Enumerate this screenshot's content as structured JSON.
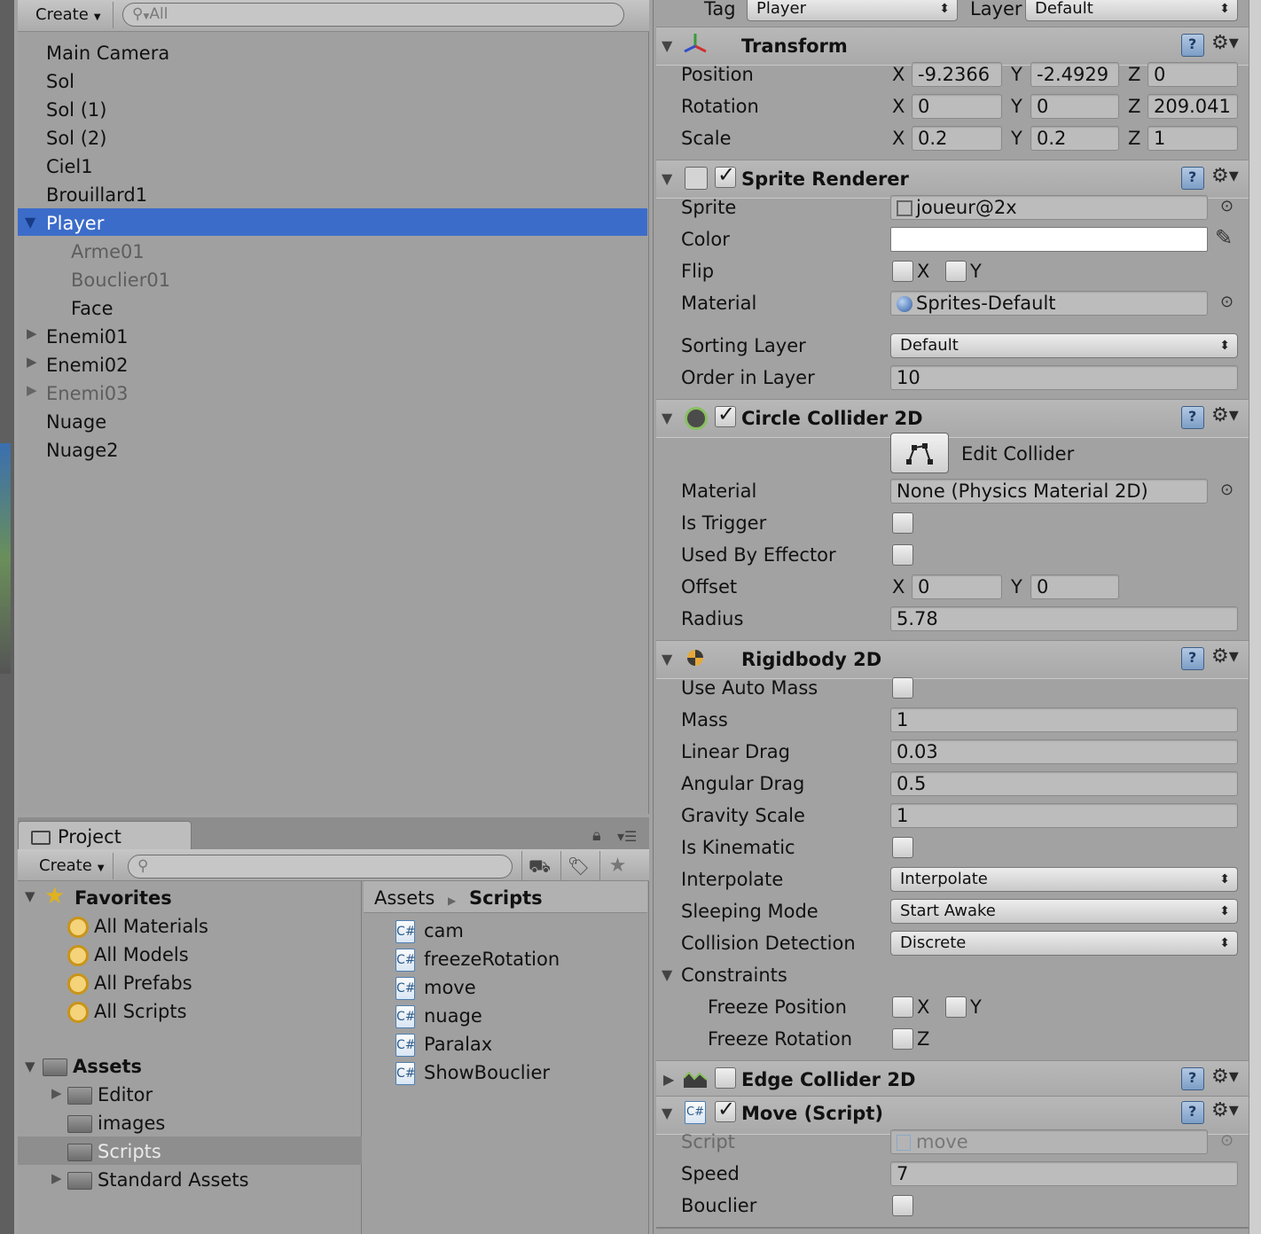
{
  "hierarchy": {
    "create_label": "Create",
    "search_placeholder": "All",
    "items": [
      {
        "label": "Main Camera"
      },
      {
        "label": "Sol"
      },
      {
        "label": "Sol (1)"
      },
      {
        "label": "Sol (2)"
      },
      {
        "label": "Ciel1"
      },
      {
        "label": "Brouillard1"
      },
      {
        "label": "Player"
      },
      {
        "label": "Arme01"
      },
      {
        "label": "Bouclier01"
      },
      {
        "label": "Face"
      },
      {
        "label": "Enemi01"
      },
      {
        "label": "Enemi02"
      },
      {
        "label": "Enemi03"
      },
      {
        "label": "Nuage"
      },
      {
        "label": "Nuage2"
      }
    ]
  },
  "project": {
    "tab_label": "Project",
    "create_label": "Create",
    "favorites_label": "Favorites",
    "favorites": [
      "All Materials",
      "All Models",
      "All Prefabs",
      "All Scripts"
    ],
    "assets_label": "Assets",
    "folders": [
      "Editor",
      "images",
      "Scripts",
      "Standard Assets"
    ],
    "breadcrumb_root": "Assets",
    "breadcrumb_current": "Scripts",
    "files": [
      "cam",
      "freezeRotation",
      "move",
      "nuage",
      "Paralax",
      "ShowBouclier"
    ]
  },
  "inspector": {
    "tag_label": "Tag",
    "tag_value": "Player",
    "layer_label": "Layer",
    "layer_value": "Default",
    "transform": {
      "title": "Transform",
      "position_label": "Position",
      "rotation_label": "Rotation",
      "scale_label": "Scale",
      "x": "X",
      "y": "Y",
      "z": "Z",
      "pos_x": "-9.2366",
      "pos_y": "-2.4929",
      "pos_z": "0",
      "rot_x": "0",
      "rot_y": "0",
      "rot_z": "209.041",
      "scale_x": "0.2",
      "scale_y": "0.2",
      "scale_z": "1"
    },
    "sprite_renderer": {
      "title": "Sprite Renderer",
      "sprite_label": "Sprite",
      "sprite_value": "joueur@2x",
      "color_label": "Color",
      "flip_label": "Flip",
      "flip_x": "X",
      "flip_y": "Y",
      "material_label": "Material",
      "material_value": "Sprites-Default",
      "sorting_layer_label": "Sorting Layer",
      "sorting_layer_value": "Default",
      "order_label": "Order in Layer",
      "order_value": "10"
    },
    "circle_collider": {
      "title": "Circle Collider 2D",
      "edit_label": "Edit Collider",
      "material_label": "Material",
      "material_value": "None (Physics Material 2D)",
      "is_trigger_label": "Is Trigger",
      "used_by_effector_label": "Used By Effector",
      "offset_label": "Offset",
      "offset_x": "0",
      "offset_y": "0",
      "radius_label": "Radius",
      "radius_value": "5.78"
    },
    "rigidbody": {
      "title": "Rigidbody 2D",
      "use_auto_mass_label": "Use Auto Mass",
      "mass_label": "Mass",
      "mass_value": "1",
      "linear_drag_label": "Linear Drag",
      "linear_drag_value": "0.03",
      "angular_drag_label": "Angular Drag",
      "angular_drag_value": "0.5",
      "gravity_label": "Gravity Scale",
      "gravity_value": "1",
      "kinematic_label": "Is Kinematic",
      "interpolate_label": "Interpolate",
      "interpolate_value": "Interpolate",
      "sleeping_label": "Sleeping Mode",
      "sleeping_value": "Start Awake",
      "collision_label": "Collision Detection",
      "collision_value": "Discrete",
      "constraints_label": "Constraints",
      "freeze_pos_label": "Freeze Position",
      "freeze_rot_label": "Freeze Rotation",
      "x": "X",
      "y": "Y",
      "z": "Z"
    },
    "edge_collider": {
      "title": "Edge Collider 2D"
    },
    "move_script": {
      "title": "Move (Script)",
      "script_label": "Script",
      "script_value": "move",
      "speed_label": "Speed",
      "speed_value": "7",
      "bouclier_label": "Bouclier"
    }
  }
}
